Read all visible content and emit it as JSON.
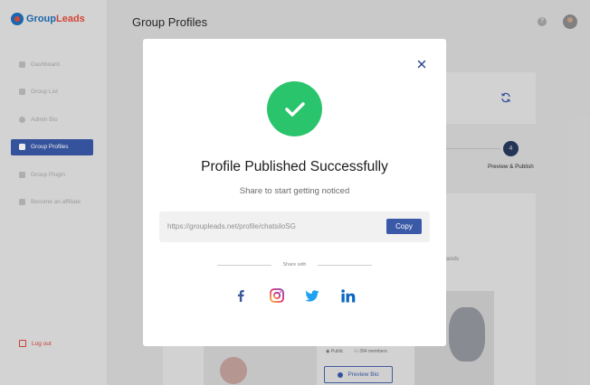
{
  "app": {
    "name_part1": "Group",
    "name_part2": "Leads"
  },
  "header": {
    "title": "Group Profiles",
    "help_icon": "?"
  },
  "sidebar": {
    "items": [
      {
        "label": "Dashboard",
        "icon": "grid-icon"
      },
      {
        "label": "Group List",
        "icon": "list-icon"
      },
      {
        "label": "Admin Bio",
        "icon": "user-icon"
      },
      {
        "label": "Group Profiles",
        "icon": "profile-icon",
        "active": true
      },
      {
        "label": "Group Plugin",
        "icon": "plugin-icon"
      },
      {
        "label": "Become an affiliate",
        "icon": "thumbs-up-icon"
      }
    ],
    "logout": "Log out"
  },
  "background": {
    "step_number": "4",
    "step_label": "Preview & Publish",
    "ands_text": "ands",
    "meta_public": "Public",
    "meta_members": "394 members",
    "preview_button": "Preview Bio"
  },
  "modal": {
    "title": "Profile Published Successfully",
    "subtitle": "Share to start getting noticed",
    "url": "https://groupleads.net/profile/chatsiloSG",
    "copy_label": "Copy",
    "share_with": "Share with",
    "social": [
      "facebook",
      "instagram",
      "twitter",
      "linkedin"
    ]
  },
  "colors": {
    "primary": "#3a5aa8",
    "success": "#2ac46c",
    "logout": "#d8453a",
    "facebook": "#3b5998",
    "twitter": "#1da1f2",
    "linkedin": "#0a66c2"
  }
}
